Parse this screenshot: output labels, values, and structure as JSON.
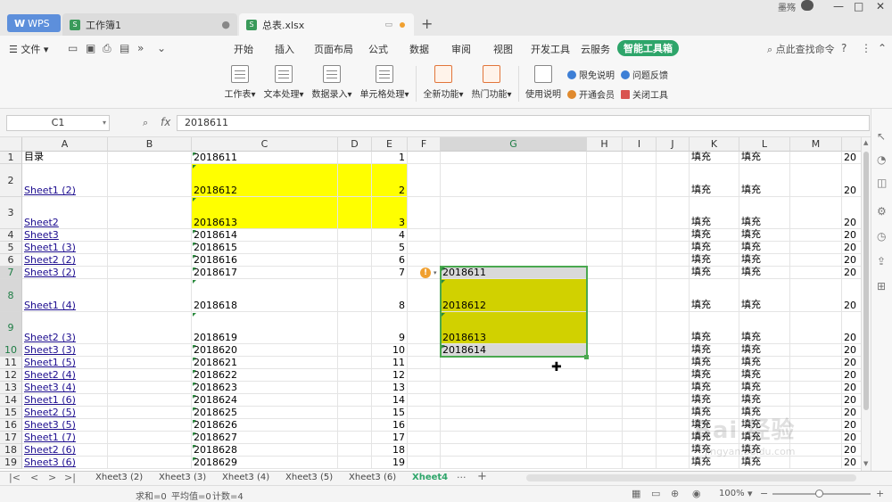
{
  "title_bar": {
    "wps_tab": "WPS",
    "tabs": [
      {
        "name": "工作簿1"
      },
      {
        "name": "总表.xlsx"
      }
    ],
    "user_name": "墨殇"
  },
  "menu": {
    "file": "文件",
    "tabs": [
      "开始",
      "插入",
      "页面布局",
      "公式",
      "数据",
      "审阅",
      "视图",
      "开发工具",
      "云服务",
      "智能工具箱"
    ],
    "active_tab": "智能工具箱",
    "search": "点此查找命令"
  },
  "ribbon": {
    "buttons": [
      {
        "label": "工作表",
        "dropdown": "▾"
      },
      {
        "label": "文本处理",
        "dropdown": "▾"
      },
      {
        "label": "数据录入",
        "dropdown": "▾"
      },
      {
        "label": "单元格处理",
        "dropdown": "▾"
      },
      {
        "label": "全新功能",
        "dropdown": "▾"
      },
      {
        "label": "热门功能",
        "dropdown": "▾"
      },
      {
        "label": "使用说明",
        "dropdown": ""
      }
    ],
    "small": [
      {
        "label": "限免说明",
        "color": "#3d7fd6"
      },
      {
        "label": "问题反馈",
        "color": "#3d7fd6"
      },
      {
        "label": "开通会员",
        "color": "#e08a2e"
      },
      {
        "label": "关闭工具",
        "color": "#d9534f"
      }
    ]
  },
  "formula_bar": {
    "name_box": "C1",
    "fx": "fx",
    "value": "2018611"
  },
  "columns": [
    "A",
    "B",
    "C",
    "D",
    "E",
    "F",
    "G",
    "H",
    "I",
    "J",
    "K",
    "L",
    "M"
  ],
  "rows": [
    {
      "num": "1",
      "a": "目录",
      "c": "2018611",
      "e": "1",
      "g": "",
      "k": "填充",
      "l": "填充",
      "n": "20"
    },
    {
      "num": "2",
      "a": "Sheet1 (2)",
      "c": "2018612",
      "e": "2",
      "g": "",
      "k": "填充",
      "l": "填充",
      "n": "20"
    },
    {
      "num": "3",
      "a": "Sheet2",
      "c": "2018613",
      "e": "3",
      "g": "",
      "k": "填充",
      "l": "填充",
      "n": "20"
    },
    {
      "num": "4",
      "a": "Sheet3",
      "c": "2018614",
      "e": "4",
      "g": "",
      "k": "填充",
      "l": "填充",
      "n": "20"
    },
    {
      "num": "5",
      "a": "Sheet1 (3)",
      "c": "2018615",
      "e": "5",
      "g": "",
      "k": "填充",
      "l": "填充",
      "n": "20"
    },
    {
      "num": "6",
      "a": "Sheet2 (2)",
      "c": "2018616",
      "e": "6",
      "g": "",
      "k": "填充",
      "l": "填充",
      "n": "20"
    },
    {
      "num": "7",
      "a": "Sheet3 (2)",
      "c": "2018617",
      "e": "7",
      "g": "2018611",
      "k": "填充",
      "l": "填充",
      "n": "20"
    },
    {
      "num": "8",
      "a": "Sheet1 (4)",
      "c": "2018618",
      "e": "8",
      "g": "2018612",
      "k": "填充",
      "l": "填充",
      "n": "20"
    },
    {
      "num": "9",
      "a": "Sheet2 (3)",
      "c": "2018619",
      "e": "9",
      "g": "2018613",
      "k": "填充",
      "l": "填充",
      "n": "20"
    },
    {
      "num": "10",
      "a": "Sheet3 (3)",
      "c": "2018620",
      "e": "10",
      "g": "2018614",
      "k": "填充",
      "l": "填充",
      "n": "20"
    },
    {
      "num": "11",
      "a": "Sheet1 (5)",
      "c": "2018621",
      "e": "11",
      "g": "",
      "k": "填充",
      "l": "填充",
      "n": "20"
    },
    {
      "num": "12",
      "a": "Sheet2 (4)",
      "c": "2018622",
      "e": "12",
      "g": "",
      "k": "填充",
      "l": "填充",
      "n": "20"
    },
    {
      "num": "13",
      "a": "Sheet3 (4)",
      "c": "2018623",
      "e": "13",
      "g": "",
      "k": "填充",
      "l": "填充",
      "n": "20"
    },
    {
      "num": "14",
      "a": "Sheet1 (6)",
      "c": "2018624",
      "e": "14",
      "g": "",
      "k": "填充",
      "l": "填充",
      "n": "20"
    },
    {
      "num": "15",
      "a": "Sheet2 (5)",
      "c": "2018625",
      "e": "15",
      "g": "",
      "k": "填充",
      "l": "填充",
      "n": "20"
    },
    {
      "num": "16",
      "a": "Sheet3 (5)",
      "c": "2018626",
      "e": "16",
      "g": "",
      "k": "填充",
      "l": "填充",
      "n": "20"
    },
    {
      "num": "17",
      "a": "Sheet1 (7)",
      "c": "2018627",
      "e": "17",
      "g": "",
      "k": "填充",
      "l": "填充",
      "n": "20"
    },
    {
      "num": "18",
      "a": "Sheet2 (6)",
      "c": "2018628",
      "e": "18",
      "g": "",
      "k": "填充",
      "l": "填充",
      "n": "20"
    },
    {
      "num": "19",
      "a": "Sheet3 (6)",
      "c": "2018629",
      "e": "19",
      "g": "",
      "k": "填充",
      "l": "填充",
      "n": "20"
    }
  ],
  "sheet_tabs": [
    "Xheet3 (2)",
    "Xheet3 (3)",
    "Xheet3 (4)",
    "Xheet3 (5)",
    "Xheet3 (6)",
    "Xheet4"
  ],
  "active_sheet": "Xheet4",
  "status": {
    "sum": "求和=0",
    "avg": "平均值=0",
    "count": "计数=4",
    "zoom": "100%"
  },
  "watermark": {
    "text": "Bai 经验",
    "url": "jingyan.baidu.com"
  },
  "colors": {
    "accent": "#2ea56a",
    "highlight": "#ffff00",
    "selection": "#d1d100",
    "link": "#1b0b8e"
  }
}
